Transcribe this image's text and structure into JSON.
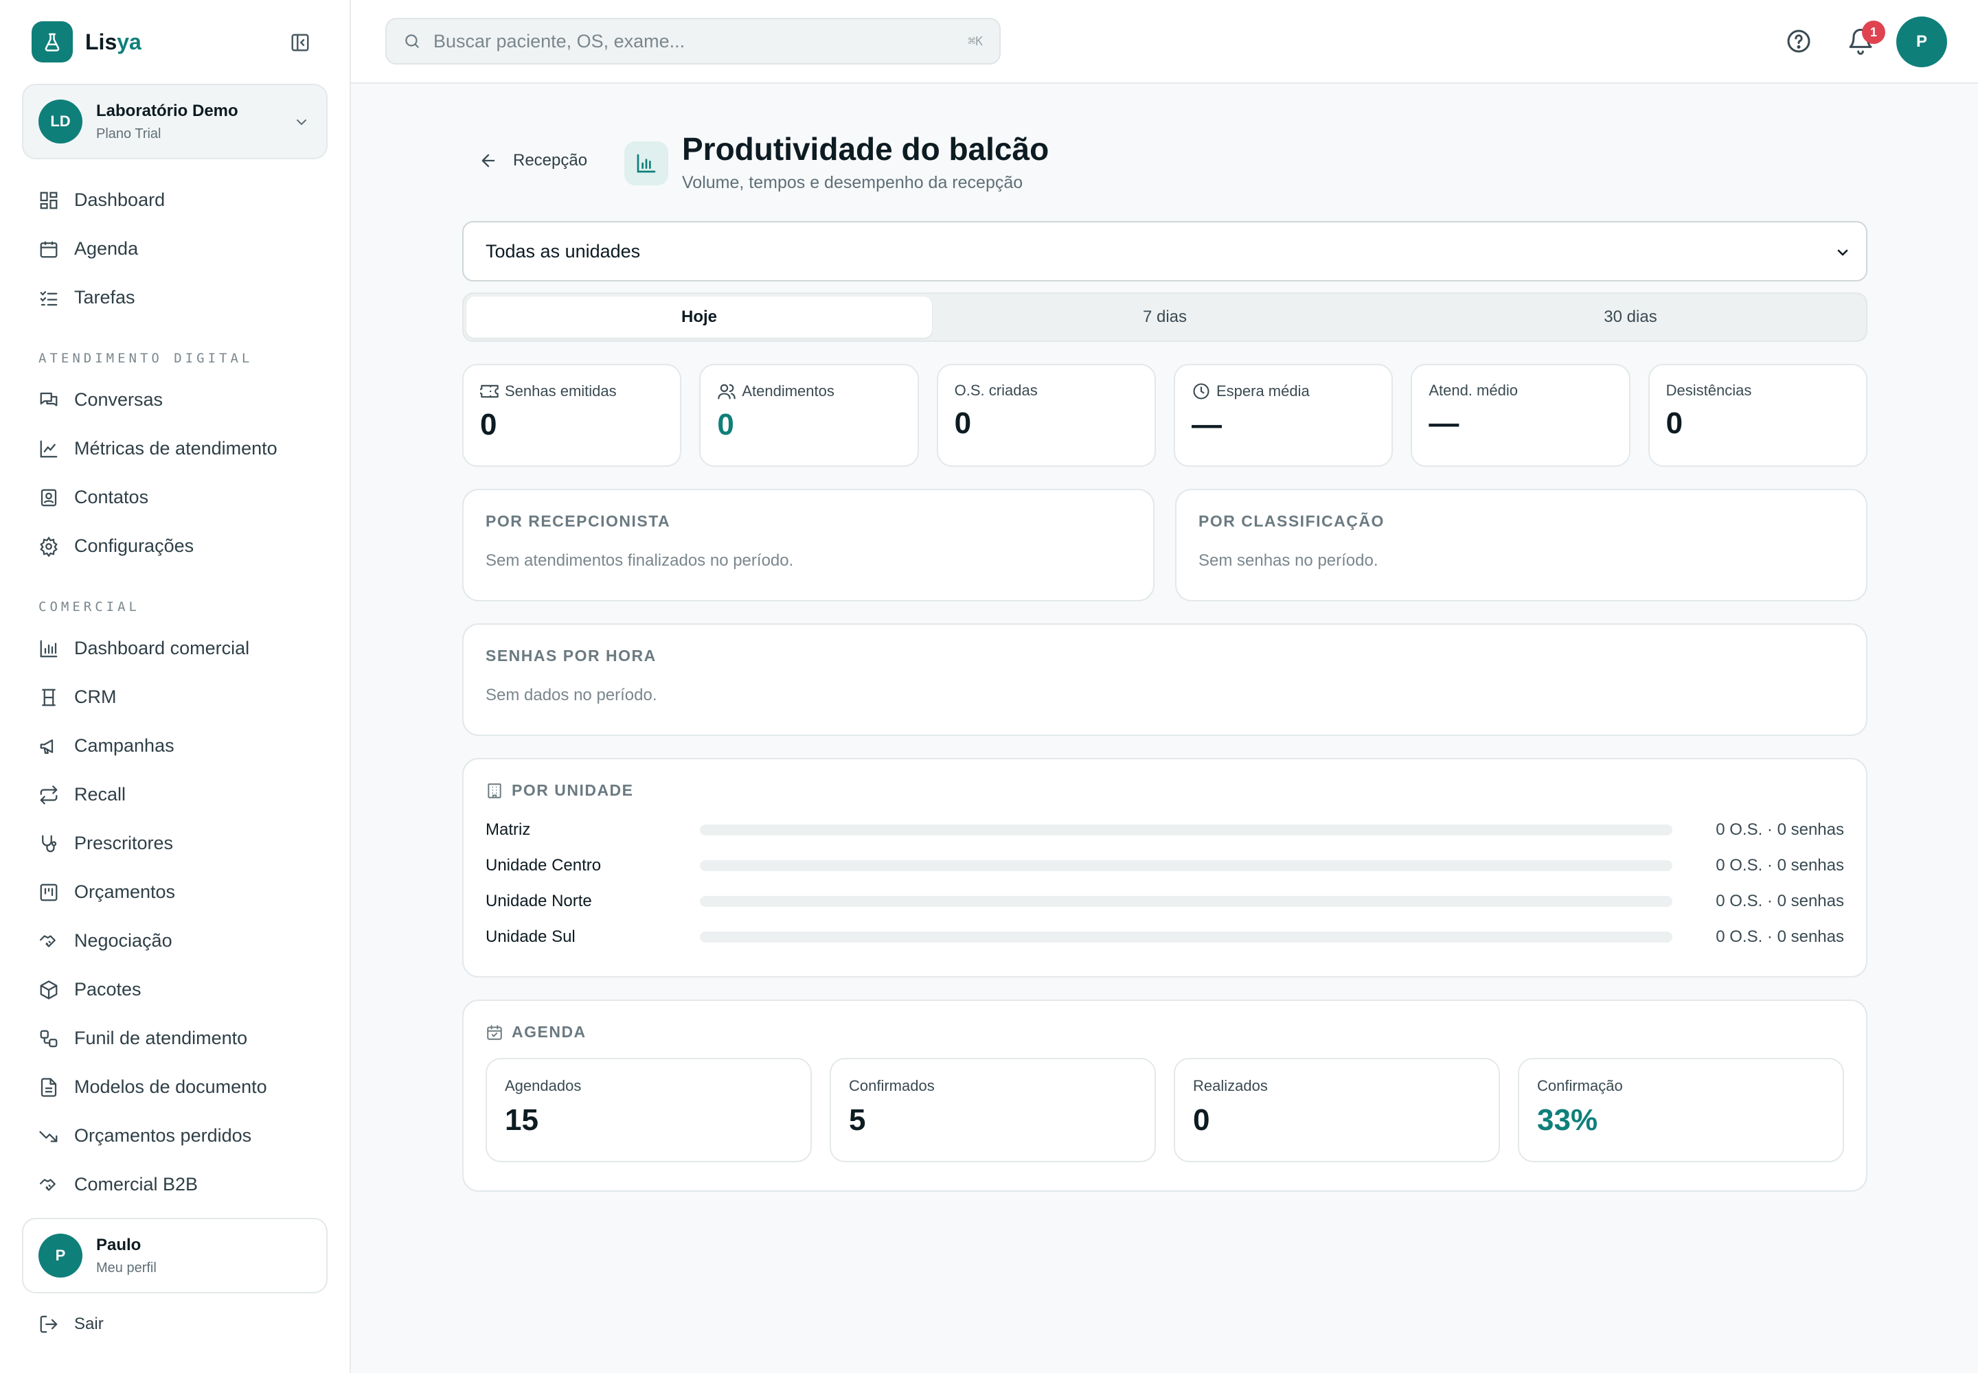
{
  "brand": {
    "name_start": "Lis",
    "name_accent": "ya"
  },
  "org": {
    "initials": "LD",
    "name": "Laboratório Demo",
    "plan": "Plano Trial"
  },
  "nav_main": [
    {
      "label": "Dashboard",
      "icon": "dashboard-icon"
    },
    {
      "label": "Agenda",
      "icon": "calendar-icon"
    },
    {
      "label": "Tarefas",
      "icon": "tasks-icon"
    }
  ],
  "section_digital": "ATENDIMENTO DIGITAL",
  "nav_digital": [
    {
      "label": "Conversas",
      "icon": "chat-icon"
    },
    {
      "label": "Métricas de atendimento",
      "icon": "line-chart-icon"
    },
    {
      "label": "Contatos",
      "icon": "contacts-icon"
    },
    {
      "label": "Configurações",
      "icon": "gear-icon"
    }
  ],
  "section_comercial": "COMERCIAL",
  "nav_comercial": [
    {
      "label": "Dashboard comercial",
      "icon": "bar-chart-icon"
    },
    {
      "label": "CRM",
      "icon": "crm-icon"
    },
    {
      "label": "Campanhas",
      "icon": "megaphone-icon"
    },
    {
      "label": "Recall",
      "icon": "repeat-icon"
    },
    {
      "label": "Prescritores",
      "icon": "stethoscope-icon"
    },
    {
      "label": "Orçamentos",
      "icon": "kanban-icon"
    },
    {
      "label": "Negociação",
      "icon": "handshake-icon"
    },
    {
      "label": "Pacotes",
      "icon": "package-icon"
    },
    {
      "label": "Funil de atendimento",
      "icon": "workflow-icon"
    },
    {
      "label": "Modelos de documento",
      "icon": "document-icon"
    },
    {
      "label": "Orçamentos perdidos",
      "icon": "trend-down-icon"
    },
    {
      "label": "Comercial B2B",
      "icon": "handshake-icon"
    }
  ],
  "profile": {
    "initial": "P",
    "name": "Paulo",
    "sub": "Meu perfil"
  },
  "logout_label": "Sair",
  "search": {
    "placeholder": "Buscar paciente, OS, exame...",
    "shortcut": "⌘K"
  },
  "notifications_count": "1",
  "user_initial": "P",
  "page": {
    "back_label": "Recepção",
    "title": "Produtividade do balcão",
    "subtitle": "Volume, tempos e desempenho da recepção",
    "unit_select": "Todas as unidades",
    "periods": [
      "Hoje",
      "7 dias",
      "30 dias"
    ],
    "active_period": "Hoje"
  },
  "kpis": [
    {
      "label": "Senhas emitidas",
      "value": "0",
      "icon": "ticket-icon"
    },
    {
      "label": "Atendimentos",
      "value": "0",
      "icon": "users-icon"
    },
    {
      "label": "O.S. criadas",
      "value": "0"
    },
    {
      "label": "Espera média",
      "value": "—",
      "icon": "clock-icon"
    },
    {
      "label": "Atend. médio",
      "value": "—"
    },
    {
      "label": "Desistências",
      "value": "0"
    }
  ],
  "por_recepcionista": {
    "title": "POR RECEPCIONISTA",
    "empty": "Sem atendimentos finalizados no período."
  },
  "por_classificacao": {
    "title": "POR CLASSIFICAÇÃO",
    "empty": "Sem senhas no período."
  },
  "senhas_por_hora": {
    "title": "SENHAS POR HORA",
    "empty": "Sem dados no período."
  },
  "por_unidade": {
    "title": "POR UNIDADE",
    "rows": [
      {
        "name": "Matriz",
        "stat": "0 O.S. · 0 senhas",
        "fill": 0
      },
      {
        "name": "Unidade Centro",
        "stat": "0 O.S. · 0 senhas",
        "fill": 0
      },
      {
        "name": "Unidade Norte",
        "stat": "0 O.S. · 0 senhas",
        "fill": 0
      },
      {
        "name": "Unidade Sul",
        "stat": "0 O.S. · 0 senhas",
        "fill": 0
      }
    ]
  },
  "agenda": {
    "title": "AGENDA",
    "cards": [
      {
        "label": "Agendados",
        "value": "15"
      },
      {
        "label": "Confirmados",
        "value": "5"
      },
      {
        "label": "Realizados",
        "value": "0"
      },
      {
        "label": "Confirmação",
        "value": "33%"
      }
    ]
  },
  "colors": {
    "accent": "#0f7f7a",
    "badge": "#e04350",
    "background": "#f7f9fa"
  }
}
